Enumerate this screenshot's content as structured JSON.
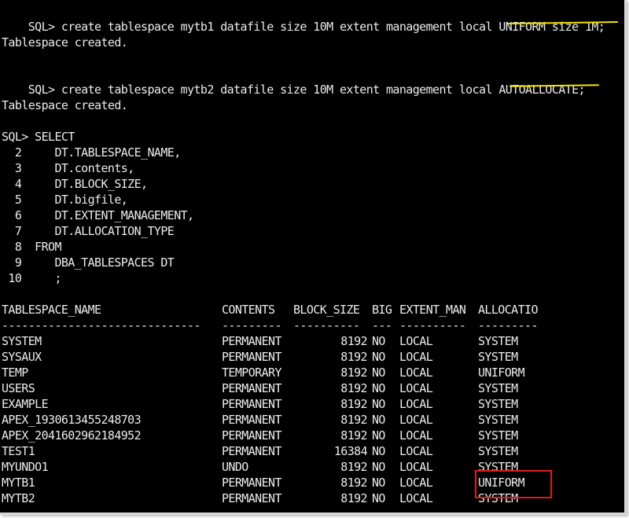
{
  "window": {
    "background": "#000000",
    "text_color": "#ececec",
    "highlight_yellow": "#f4e300",
    "highlight_red": "#e31a1a"
  },
  "commands": {
    "cmd1": {
      "prompt": "SQL> ",
      "text": "create tablespace mytb1 datafile size 10M extent management local ",
      "highlight": "UNIFORM size 1M;"
    },
    "result1": "Tablespace created.",
    "cmd2": {
      "prompt": "SQL> ",
      "text": "create tablespace mytb2 datafile size 10M extent management local ",
      "highlight": "AUTOALLOCATE;"
    },
    "result2": "Tablespace created.",
    "query_prompt": "SQL> SELECT",
    "query_lines": [
      "  2     DT.TABLESPACE_NAME,",
      "  3     DT.contents,",
      "  4     DT.BLOCK_SIZE,",
      "  5     DT.bigfile,",
      "  6     DT.EXTENT_MANAGEMENT,",
      "  7     DT.ALLOCATION_TYPE",
      "  8  FROM",
      "  9     DBA_TABLESPACES DT",
      " 10     ;"
    ]
  },
  "table": {
    "headers": [
      "TABLESPACE_NAME",
      "CONTENTS",
      "BLOCK_SIZE",
      "BIG",
      "EXTENT_MAN",
      "ALLOCATIO"
    ],
    "separators": [
      "------------------------------",
      "---------",
      "----------",
      "---",
      "----------",
      "---------"
    ],
    "rows": [
      [
        "SYSTEM",
        "PERMANENT",
        "8192",
        "NO",
        "LOCAL",
        "SYSTEM"
      ],
      [
        "SYSAUX",
        "PERMANENT",
        "8192",
        "NO",
        "LOCAL",
        "SYSTEM"
      ],
      [
        "TEMP",
        "TEMPORARY",
        "8192",
        "NO",
        "LOCAL",
        "UNIFORM"
      ],
      [
        "USERS",
        "PERMANENT",
        "8192",
        "NO",
        "LOCAL",
        "SYSTEM"
      ],
      [
        "EXAMPLE",
        "PERMANENT",
        "8192",
        "NO",
        "LOCAL",
        "SYSTEM"
      ],
      [
        "APEX_1930613455248703",
        "PERMANENT",
        "8192",
        "NO",
        "LOCAL",
        "SYSTEM"
      ],
      [
        "APEX_2041602962184952",
        "PERMANENT",
        "8192",
        "NO",
        "LOCAL",
        "SYSTEM"
      ],
      [
        "TEST1",
        "PERMANENT",
        "16384",
        "NO",
        "LOCAL",
        "SYSTEM"
      ],
      [
        "MYUNDO1",
        "UNDO",
        "8192",
        "NO",
        "LOCAL",
        "SYSTEM"
      ],
      [
        "MYTB1",
        "PERMANENT",
        "8192",
        "NO",
        "LOCAL",
        "UNIFORM"
      ],
      [
        "MYTB2",
        "PERMANENT",
        "8192",
        "NO",
        "LOCAL",
        "SYSTEM"
      ]
    ]
  }
}
